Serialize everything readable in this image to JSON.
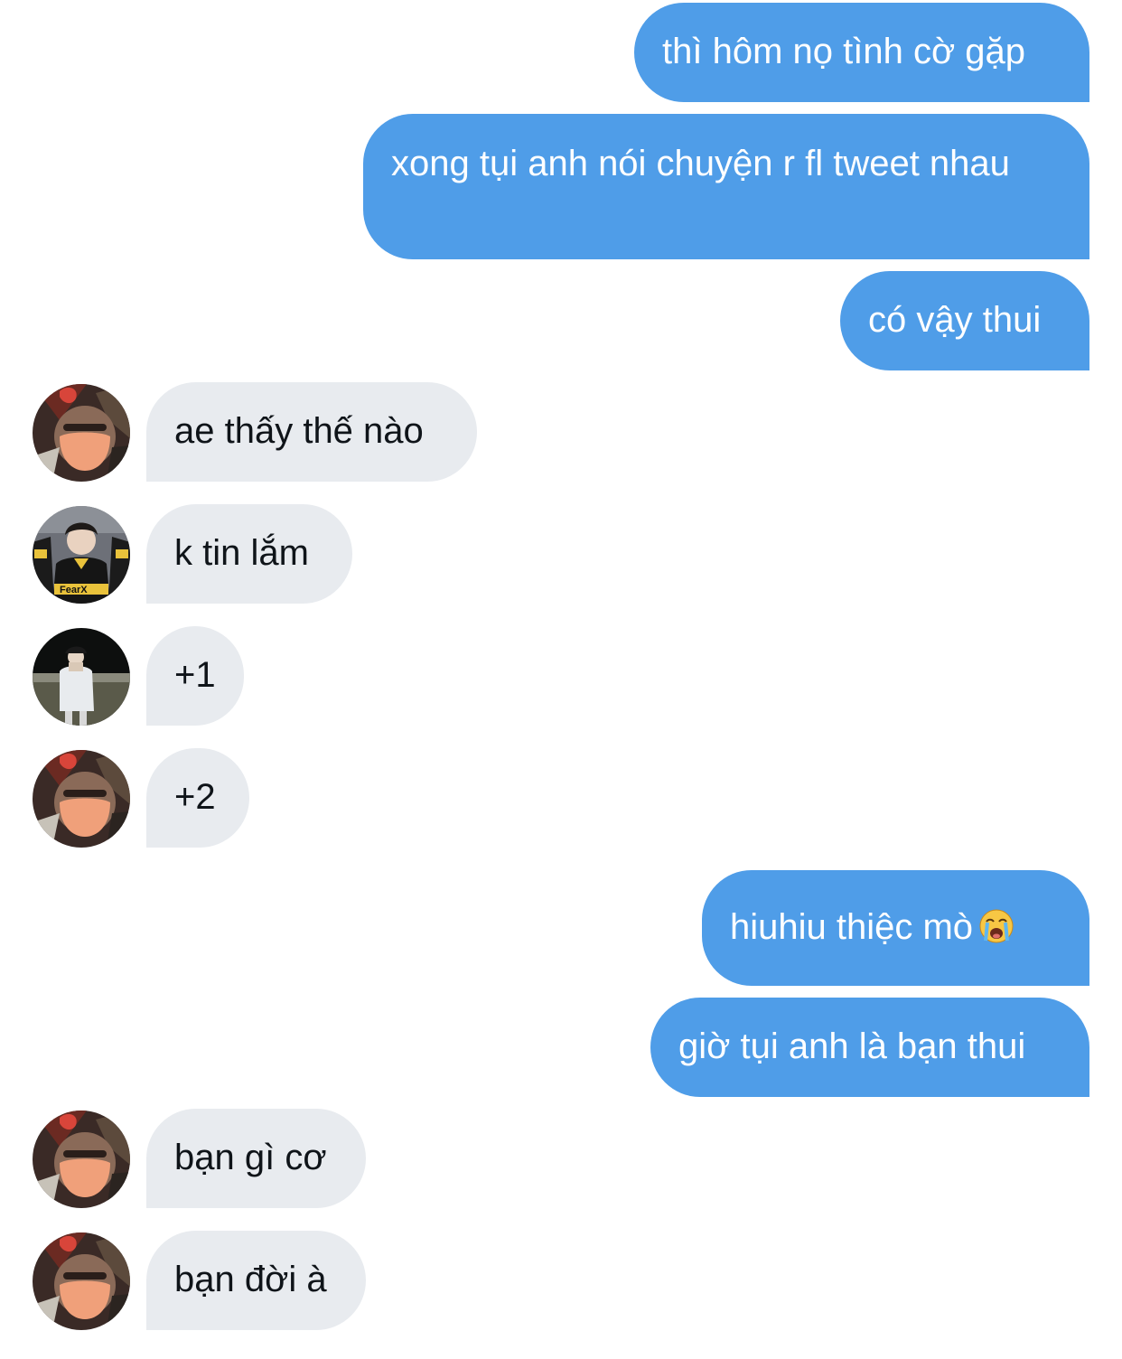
{
  "conversation": {
    "messages": [
      {
        "side": "outgoing",
        "text": "thì hôm nọ tình cờ gặp"
      },
      {
        "side": "outgoing",
        "text": "xong tụi anh nói chuyện r fl tweet nhau"
      },
      {
        "side": "outgoing",
        "text": "có vậy thui"
      },
      {
        "side": "incoming",
        "sender_avatar": "avatar-masked-user",
        "text": "ae thấy thế nào"
      },
      {
        "side": "incoming",
        "sender_avatar": "avatar-fearx-user",
        "text": "k tin lắm"
      },
      {
        "side": "incoming",
        "sender_avatar": "avatar-night-user",
        "text": "+1"
      },
      {
        "side": "incoming",
        "sender_avatar": "avatar-masked-user",
        "text": "+2"
      },
      {
        "side": "outgoing",
        "text": "hiuhiu thiệc mò",
        "emoji": "loudly-crying-face-emoji"
      },
      {
        "side": "outgoing",
        "text": "giờ tụi anh là bạn thui"
      },
      {
        "side": "incoming",
        "sender_avatar": "avatar-masked-user",
        "text": "bạn gì cơ"
      },
      {
        "side": "incoming",
        "sender_avatar": "avatar-masked-user",
        "text": "bạn đời à"
      }
    ]
  },
  "colors": {
    "outgoing_bubble": "#4f9de8",
    "incoming_bubble": "#e8ebef",
    "outgoing_text": "#ffffff",
    "incoming_text": "#0f1419"
  },
  "avatar_badges": {
    "fearx_jersey": "FearX"
  }
}
